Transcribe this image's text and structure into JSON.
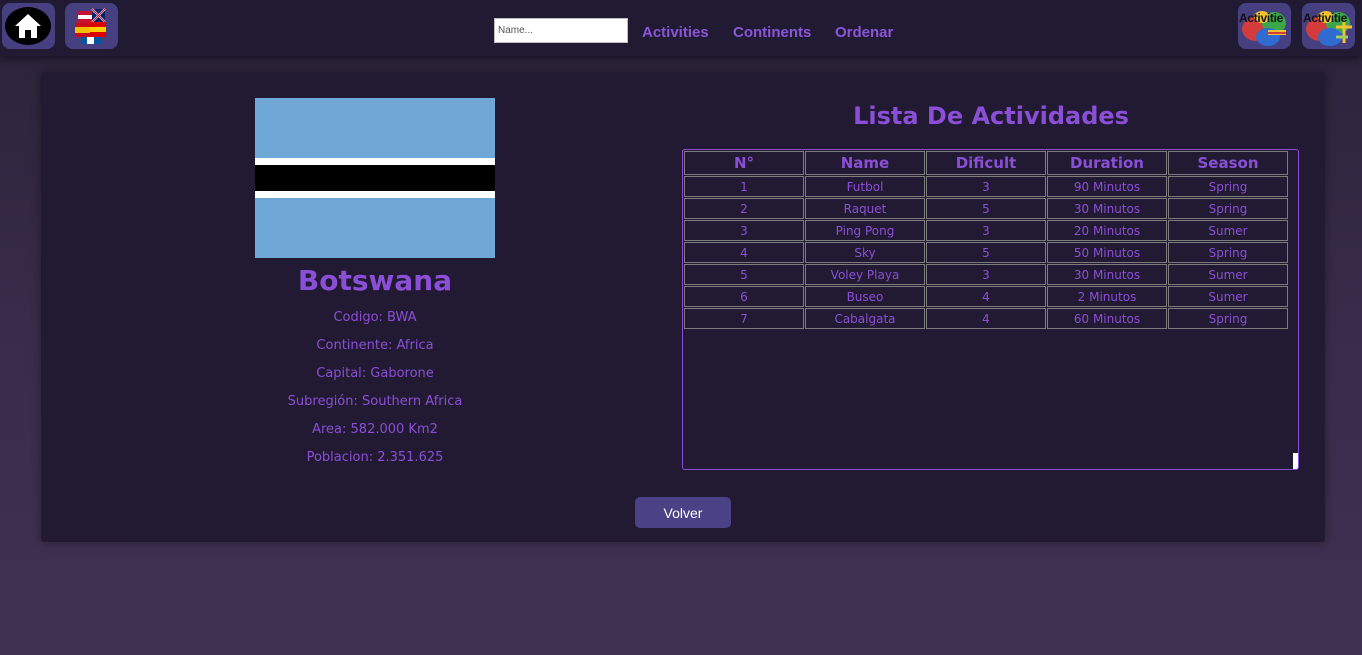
{
  "nav": {
    "search_placeholder": "Name...",
    "links": [
      "Activities",
      "Continents",
      "Ordenar"
    ],
    "activity_button_label": "Activitie"
  },
  "country": {
    "name": "Botswana",
    "details": [
      "Codigo: BWA",
      "Continente: Africa",
      "Capital: Gaborone",
      "Subregión: Southern Africa",
      "Area: 582.000 Km2",
      "Poblacion: 2.351.625"
    ]
  },
  "activities": {
    "title": "Lista De Actividades",
    "headers": [
      "N°",
      "Name",
      "Dificult",
      "Duration",
      "Season"
    ],
    "rows": [
      [
        "1",
        "Futbol",
        "3",
        "90 Minutos",
        "Spring"
      ],
      [
        "2",
        "Raquet",
        "5",
        "30 Minutos",
        "Spring"
      ],
      [
        "3",
        "Ping Pong",
        "3",
        "20 Minutos",
        "Sumer"
      ],
      [
        "4",
        "Sky",
        "5",
        "50 Minutos",
        "Spring"
      ],
      [
        "5",
        "Voley Playa",
        "3",
        "30 Minutos",
        "Sumer"
      ],
      [
        "6",
        "Buseo",
        "4",
        "2 Minutos",
        "Sumer"
      ],
      [
        "7",
        "Cabalgata",
        "4",
        "60 Minutos",
        "Spring"
      ]
    ]
  },
  "back_button": "Volver",
  "colors": {
    "accent": "#8a4fd6",
    "topbar": "#201b33",
    "card": "#211a32",
    "button": "#4a4186"
  }
}
